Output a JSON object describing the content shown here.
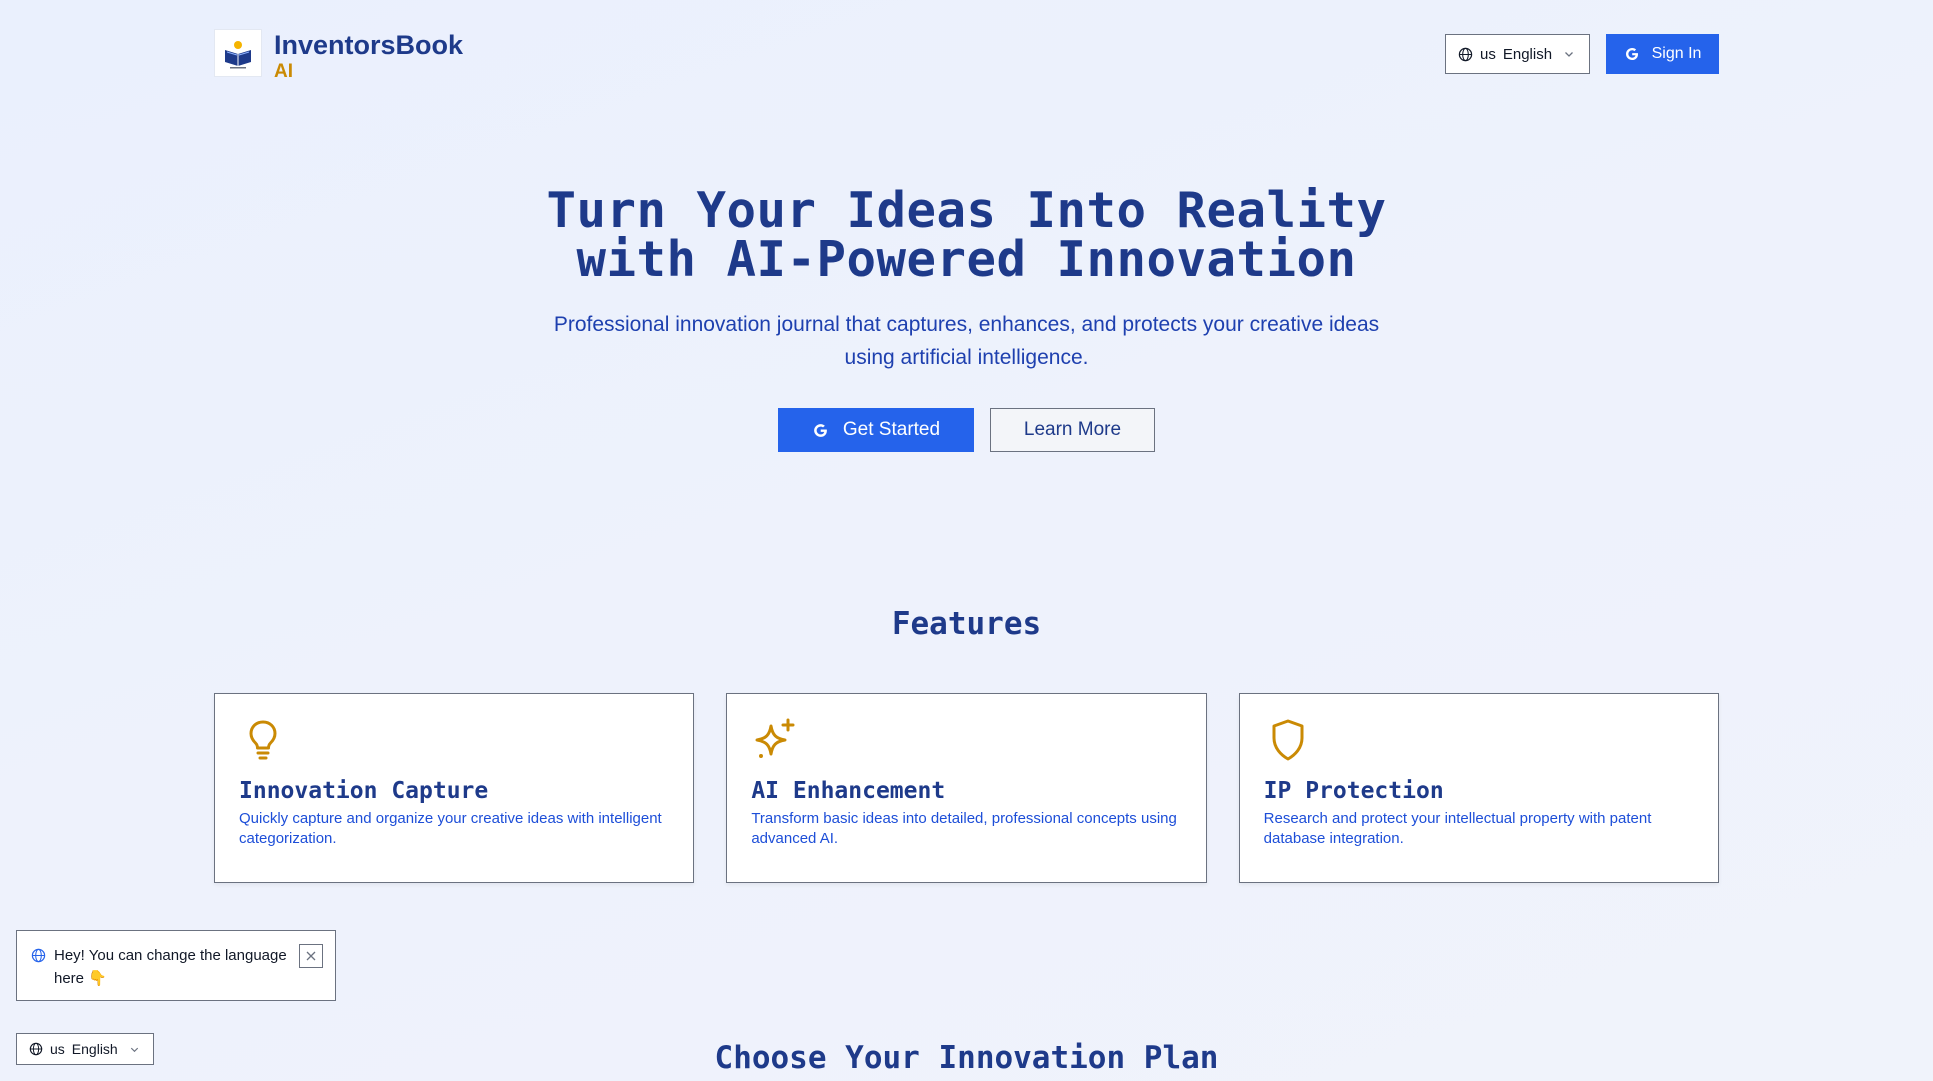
{
  "header": {
    "brand_name": "InventorsBook",
    "brand_suffix": "AI",
    "language": {
      "code": "us",
      "label": "English"
    },
    "signin_label": "Sign In"
  },
  "hero": {
    "title_line1": "Turn Your Ideas Into Reality",
    "title_line2": "with AI-Powered Innovation",
    "subtitle": "Professional innovation journal that captures, enhances, and protects your creative ideas using artificial intelligence.",
    "get_started_label": "Get Started",
    "learn_more_label": "Learn More"
  },
  "features": {
    "title": "Features",
    "cards": [
      {
        "icon": "lightbulb-icon",
        "title": "Innovation Capture",
        "description": "Quickly capture and organize your creative ideas with intelligent categorization."
      },
      {
        "icon": "sparkles-icon",
        "title": "AI Enhancement",
        "description": "Transform basic ideas into detailed, professional concepts using advanced AI."
      },
      {
        "icon": "shield-icon",
        "title": "IP Protection",
        "description": "Research and protect your intellectual property with patent database integration."
      }
    ]
  },
  "toast": {
    "message": "Hey! You can change the language here 👇"
  },
  "footer_language": {
    "code": "us",
    "label": "English"
  },
  "plans": {
    "title": "Choose Your Innovation Plan"
  },
  "colors": {
    "primary": "#2563eb",
    "navy": "#1e3a8a",
    "gold": "#ca8a04"
  }
}
